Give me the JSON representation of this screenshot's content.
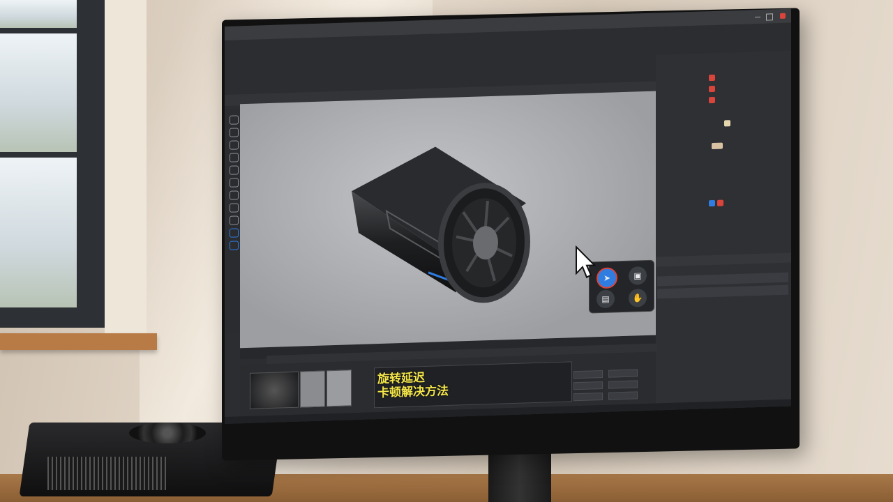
{
  "scene": {
    "description_tags": [
      "window-icon",
      "monitor-icon",
      "gpu-icon",
      "cursor-icon"
    ]
  },
  "overlay": {
    "title_line1": "旋转延迟",
    "title_line2": "卡顿解决方法"
  },
  "colors": {
    "title_yellow": "#f4e64a",
    "accent_blue": "#2f7de1",
    "accent_red": "#d9443b",
    "ui_dark": "#2b2d31"
  }
}
